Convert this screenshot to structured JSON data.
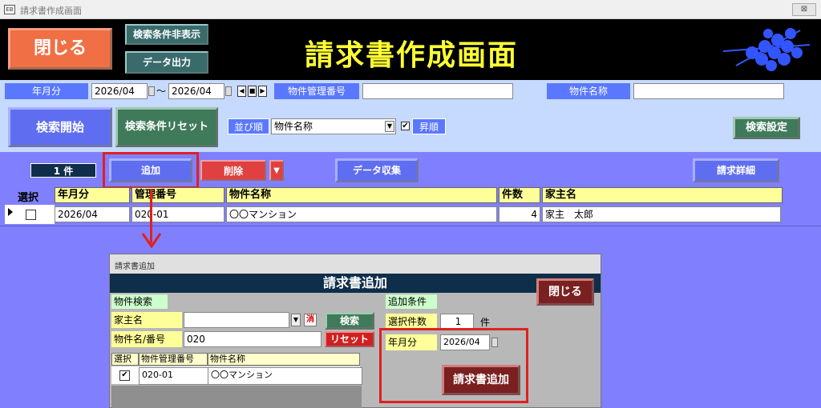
{
  "window": {
    "title": "請求書作成画面",
    "app_icon": "EB",
    "close_glyph": "⊠"
  },
  "header": {
    "close_label": "閉じる",
    "hide_conditions_label": "検索条件非表示",
    "export_label": "データ出力",
    "title": "請求書作成画面",
    "logo_icon": "molecule-logo-icon"
  },
  "filters": {
    "period_label": "年月分",
    "period_from": "2026/04",
    "tilde": "～",
    "period_to": "2026/04",
    "property_no_label": "物件管理番号",
    "property_no_value": "",
    "property_name_label": "物件名称",
    "property_name_value": ""
  },
  "search": {
    "start_label": "検索開始",
    "reset_label": "検索条件リセット",
    "sort_label": "並び順",
    "sort_value": "物件名称",
    "asc_label": "昇順",
    "asc_checked": "✔",
    "settings_label": "検索設定"
  },
  "actions": {
    "count": "1 件",
    "add_label": "追加",
    "delete_label": "削除",
    "collect_label": "データ収集",
    "detail_label": "請求詳細"
  },
  "table": {
    "columns": [
      "選択",
      "年月分",
      "管理番号",
      "物件名称",
      "件数",
      "家主名"
    ],
    "rows": [
      {
        "select": "",
        "period": "2026/04",
        "mgmt_no": "020-01",
        "property": "〇〇マンション",
        "count": "4",
        "owner": "家主　太郎"
      }
    ]
  },
  "dialog": {
    "window_title": "請求書追加",
    "heading": "請求書追加",
    "close_label": "閉じる",
    "search_section": "物件検索",
    "owner_label": "家主名",
    "owner_value": "",
    "clear_label": "消",
    "search_button": "検索",
    "name_no_label": "物件名/番号",
    "name_no_value": "020",
    "reset_button": "リセット",
    "list_columns": [
      "選択",
      "物件管理番号",
      "物件名称"
    ],
    "list_rows": [
      {
        "checked": "✔",
        "mgmt_no": "020-01",
        "property": "〇〇マンション"
      }
    ],
    "add_section": "追加条件",
    "selected_count_label": "選択件数",
    "selected_count": "1",
    "unit": "件",
    "period_label": "年月分",
    "period_value": "2026/04",
    "add_button": "請求書追加"
  },
  "colors": {
    "header_bg": "#000000",
    "title_yellow": "#ffff33",
    "highlight_red": "#e02020",
    "panel_bg": "#c6d9ff",
    "list_bg": "#8080ff"
  }
}
